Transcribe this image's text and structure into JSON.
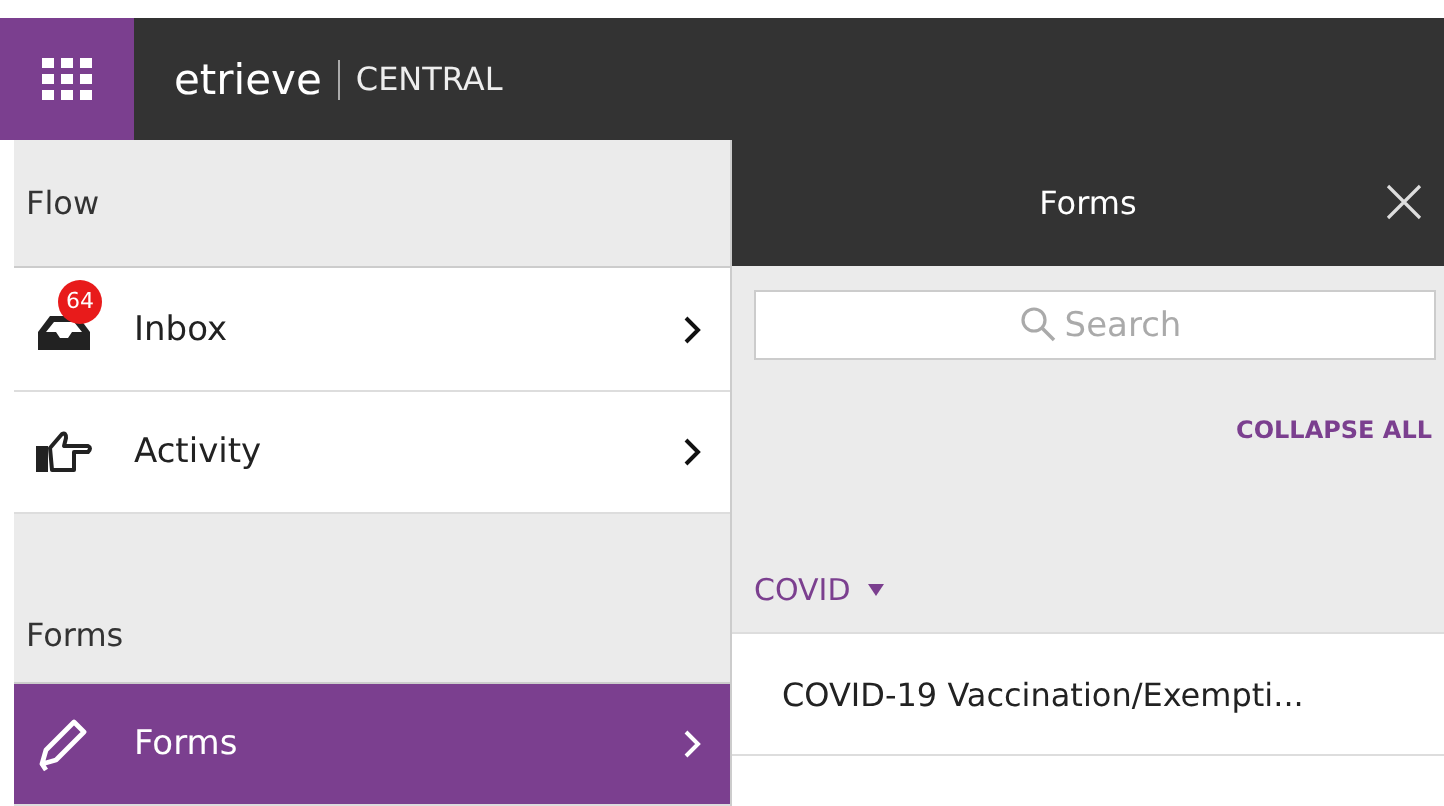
{
  "header": {
    "logo": "etrieve",
    "product": "CENTRAL"
  },
  "sidebar": {
    "sections": [
      {
        "title": "Flow",
        "items": [
          {
            "label": "Inbox",
            "badge": "64",
            "selected": false
          },
          {
            "label": "Activity",
            "selected": false
          }
        ]
      },
      {
        "title": "Forms",
        "items": [
          {
            "label": "Forms",
            "selected": true
          }
        ]
      }
    ]
  },
  "panel": {
    "title": "Forms",
    "search": {
      "placeholder": "Search"
    },
    "collapse_all": "COLLAPSE ALL",
    "groups": [
      {
        "name": "COVID",
        "expanded": true,
        "forms": [
          "COVID-19 Vaccination/Exempti..."
        ]
      }
    ]
  }
}
